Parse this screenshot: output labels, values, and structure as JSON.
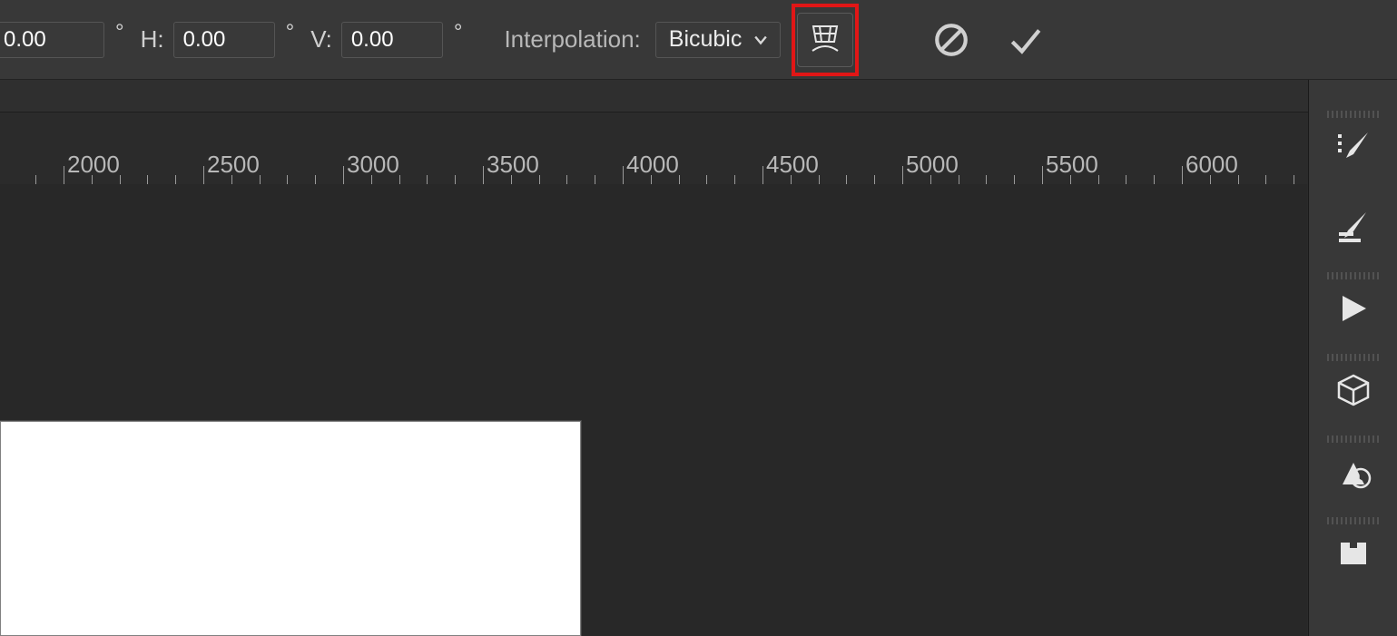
{
  "options": {
    "rotate": {
      "value": "0.00"
    },
    "h": {
      "label": "H:",
      "value": "0.00"
    },
    "v": {
      "label": "V:",
      "value": "0.00"
    },
    "degree_mark": "°",
    "interp": {
      "label": "Interpolation:",
      "value": "Bicubic"
    }
  },
  "ruler": {
    "labels": [
      "2000",
      "2500",
      "3000",
      "3500",
      "4000",
      "4500",
      "5000",
      "5500",
      "6000"
    ]
  },
  "colors": {
    "highlight": "#e11616",
    "chrome": "#383838",
    "canvas": "#282828"
  }
}
